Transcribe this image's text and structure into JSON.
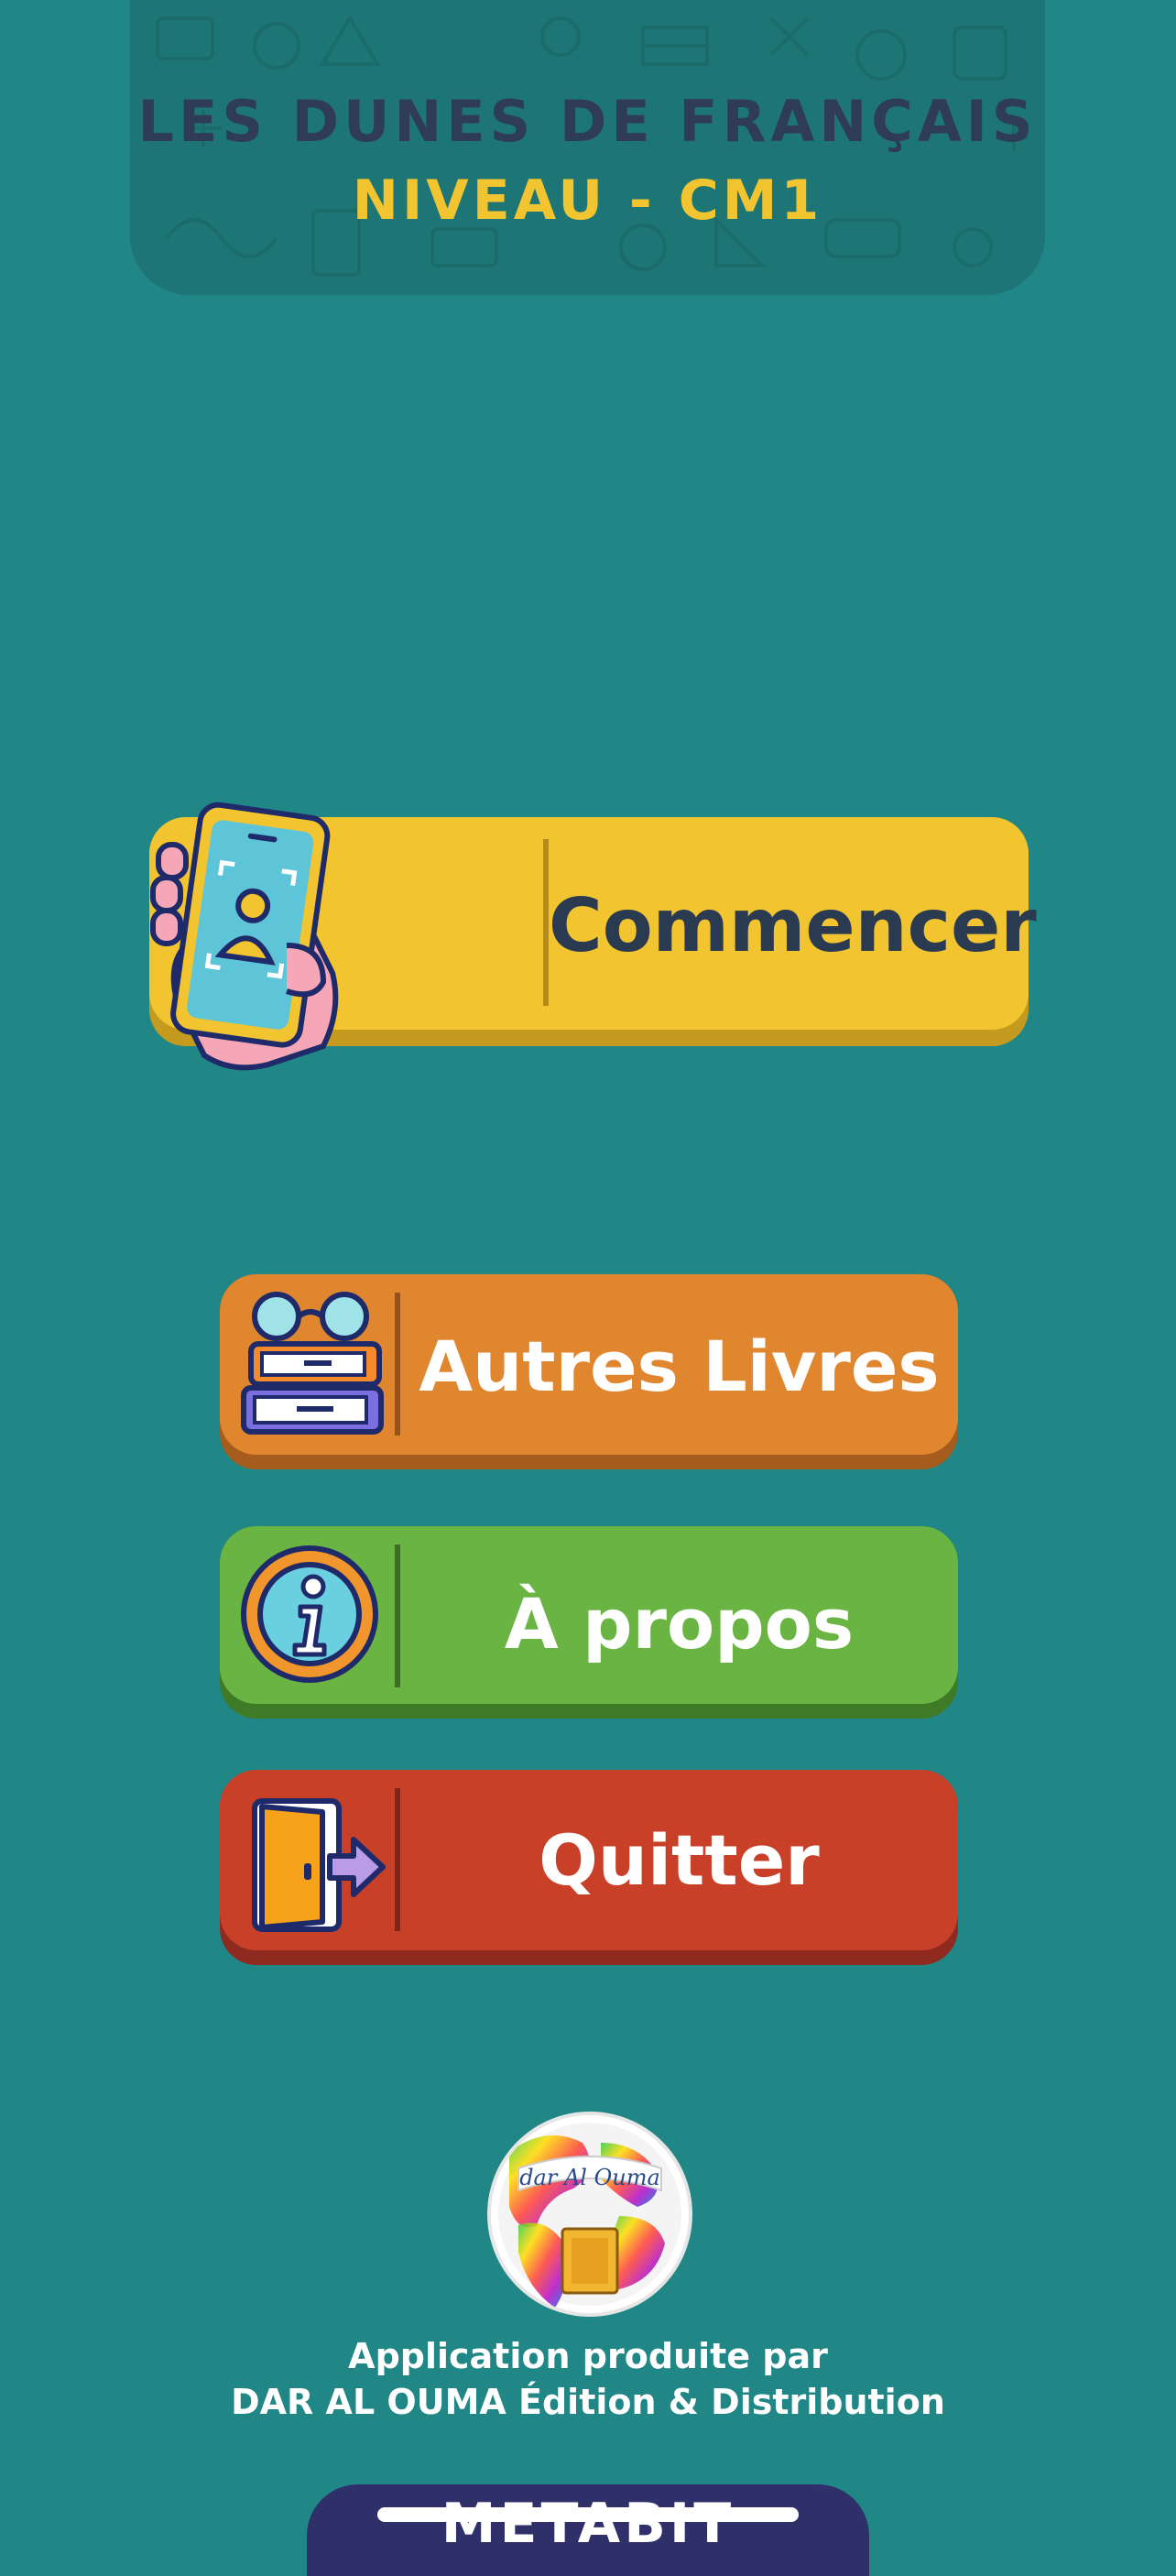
{
  "header": {
    "title": "LES DUNES DE FRANÇAIS",
    "subtitle": "NIVEAU - CM1"
  },
  "menu": {
    "start": {
      "label": "Commencer",
      "icon": "phone-in-hand-icon"
    },
    "books": {
      "label": "Autres Livres",
      "icon": "books-with-glasses-icon"
    },
    "about": {
      "label": "À propos",
      "icon": "info-icon"
    },
    "quit": {
      "label": "Quitter",
      "icon": "exit-door-icon"
    }
  },
  "publisher": {
    "logo_text": "dar Al Ouma",
    "line1": "Application produite par",
    "line2": "DAR AL OUMA Édition & Distribution"
  },
  "footer": {
    "brand": "METABIT"
  },
  "colors": {
    "background": "#218786",
    "start": "#f2c530",
    "books": "#e0862f",
    "about": "#6ab443",
    "quit": "#c94028",
    "footer": "#2f2f6a"
  }
}
